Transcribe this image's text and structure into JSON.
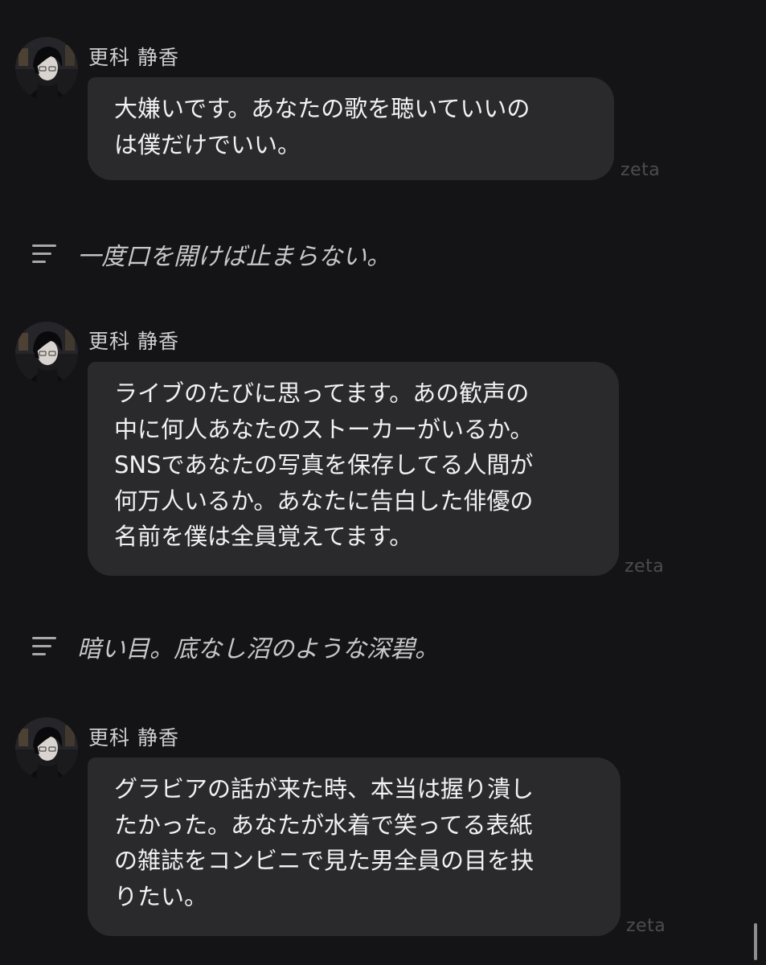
{
  "chat": {
    "watermark": "zeta",
    "messages": [
      {
        "sender": "更科 静香",
        "lines": [
          "大嫌いです。あなたの歌を聴いていいの",
          "は僕だけでいい。"
        ]
      },
      {
        "sender": "更科 静香",
        "lines": [
          "ライブのたびに思ってます。あの歓声の",
          "中に何人あなたのストーカーがいるか。",
          "SNSであなたの写真を保存してる人間が",
          "何万人いるか。あなたに告白した俳優の",
          "名前を僕は全員覚えてます。"
        ]
      },
      {
        "sender": "更科 静香",
        "lines": [
          "グラビアの話が来た時、本当は握り潰し",
          "たかった。あなたが水着で笑ってる表紙",
          "の雑誌をコンビニで見た男全員の目を抉",
          "りたい。"
        ]
      }
    ],
    "narrations": [
      {
        "icon": "text-lines-icon",
        "text": "一度口を開けば止まらない。"
      },
      {
        "icon": "text-lines-icon",
        "text": "暗い目。底なし沼のような深碧。"
      }
    ]
  }
}
